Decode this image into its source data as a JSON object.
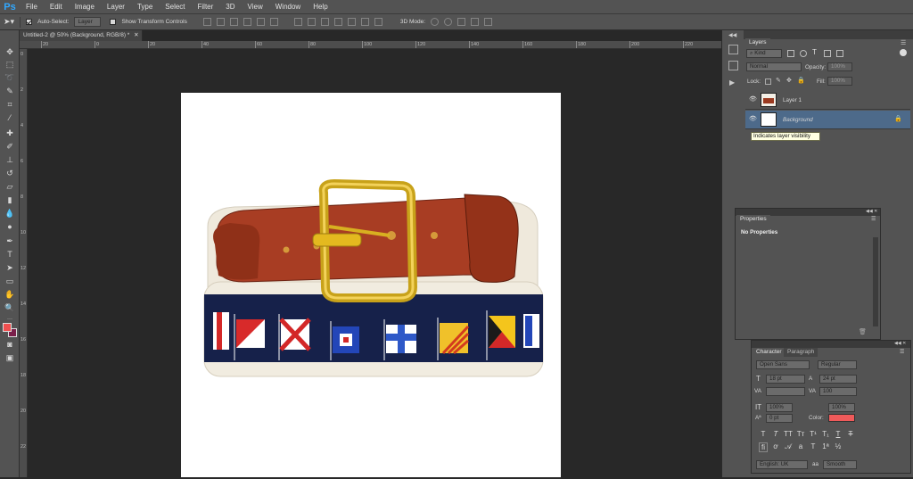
{
  "app": {
    "logo": "Ps"
  },
  "menu": [
    "File",
    "Edit",
    "Image",
    "Layer",
    "Type",
    "Select",
    "Filter",
    "3D",
    "View",
    "Window",
    "Help"
  ],
  "options": {
    "auto_select_label": "Auto-Select:",
    "auto_select_value": "Layer",
    "show_transform_label": "Show Transform Controls",
    "mode_3d_label": "3D Mode:"
  },
  "document": {
    "tab_title": "Untitled-2 @ 50% (Background, RGB/8) *",
    "ruler_h_labels": [
      "20",
      "0",
      "20",
      "40",
      "60",
      "80",
      "100",
      "120",
      "140",
      "160",
      "180",
      "200",
      "220",
      "240",
      "260",
      "280"
    ],
    "ruler_v_labels": [
      "0",
      "2",
      "4",
      "6",
      "8",
      "10",
      "12",
      "14",
      "16",
      "18",
      "20",
      "22"
    ]
  },
  "layers_panel": {
    "tab": "Layers",
    "filter_kind": "Kind",
    "blend_mode": "Normal",
    "opacity_label": "Opacity:",
    "opacity_value": "100%",
    "lock_label": "Lock:",
    "fill_label": "Fill:",
    "fill_value": "100%",
    "layers": [
      {
        "name": "Layer 1",
        "selected": false
      },
      {
        "name": "Background",
        "selected": true
      }
    ],
    "tooltip": "Indicates layer visibility"
  },
  "properties_panel": {
    "tab": "Properties",
    "message": "No Properties"
  },
  "character_panel": {
    "tabs": [
      "Character",
      "Paragraph"
    ],
    "font_family": "Open Sans",
    "font_style": "Regular",
    "font_size": "18 pt",
    "leading": "24 pt",
    "kerning": "",
    "tracking": "100",
    "vertical_scale": "100%",
    "horizontal_scale": "100%",
    "baseline_shift": "0 pt",
    "color_label": "Color:",
    "color_value": "#ef5a5a",
    "language": "English: UK",
    "antialias": "Smooth"
  },
  "colors": {
    "foreground": "#ef4f4f",
    "background": "#2c2c2c",
    "selection": "#4d6a8a"
  }
}
